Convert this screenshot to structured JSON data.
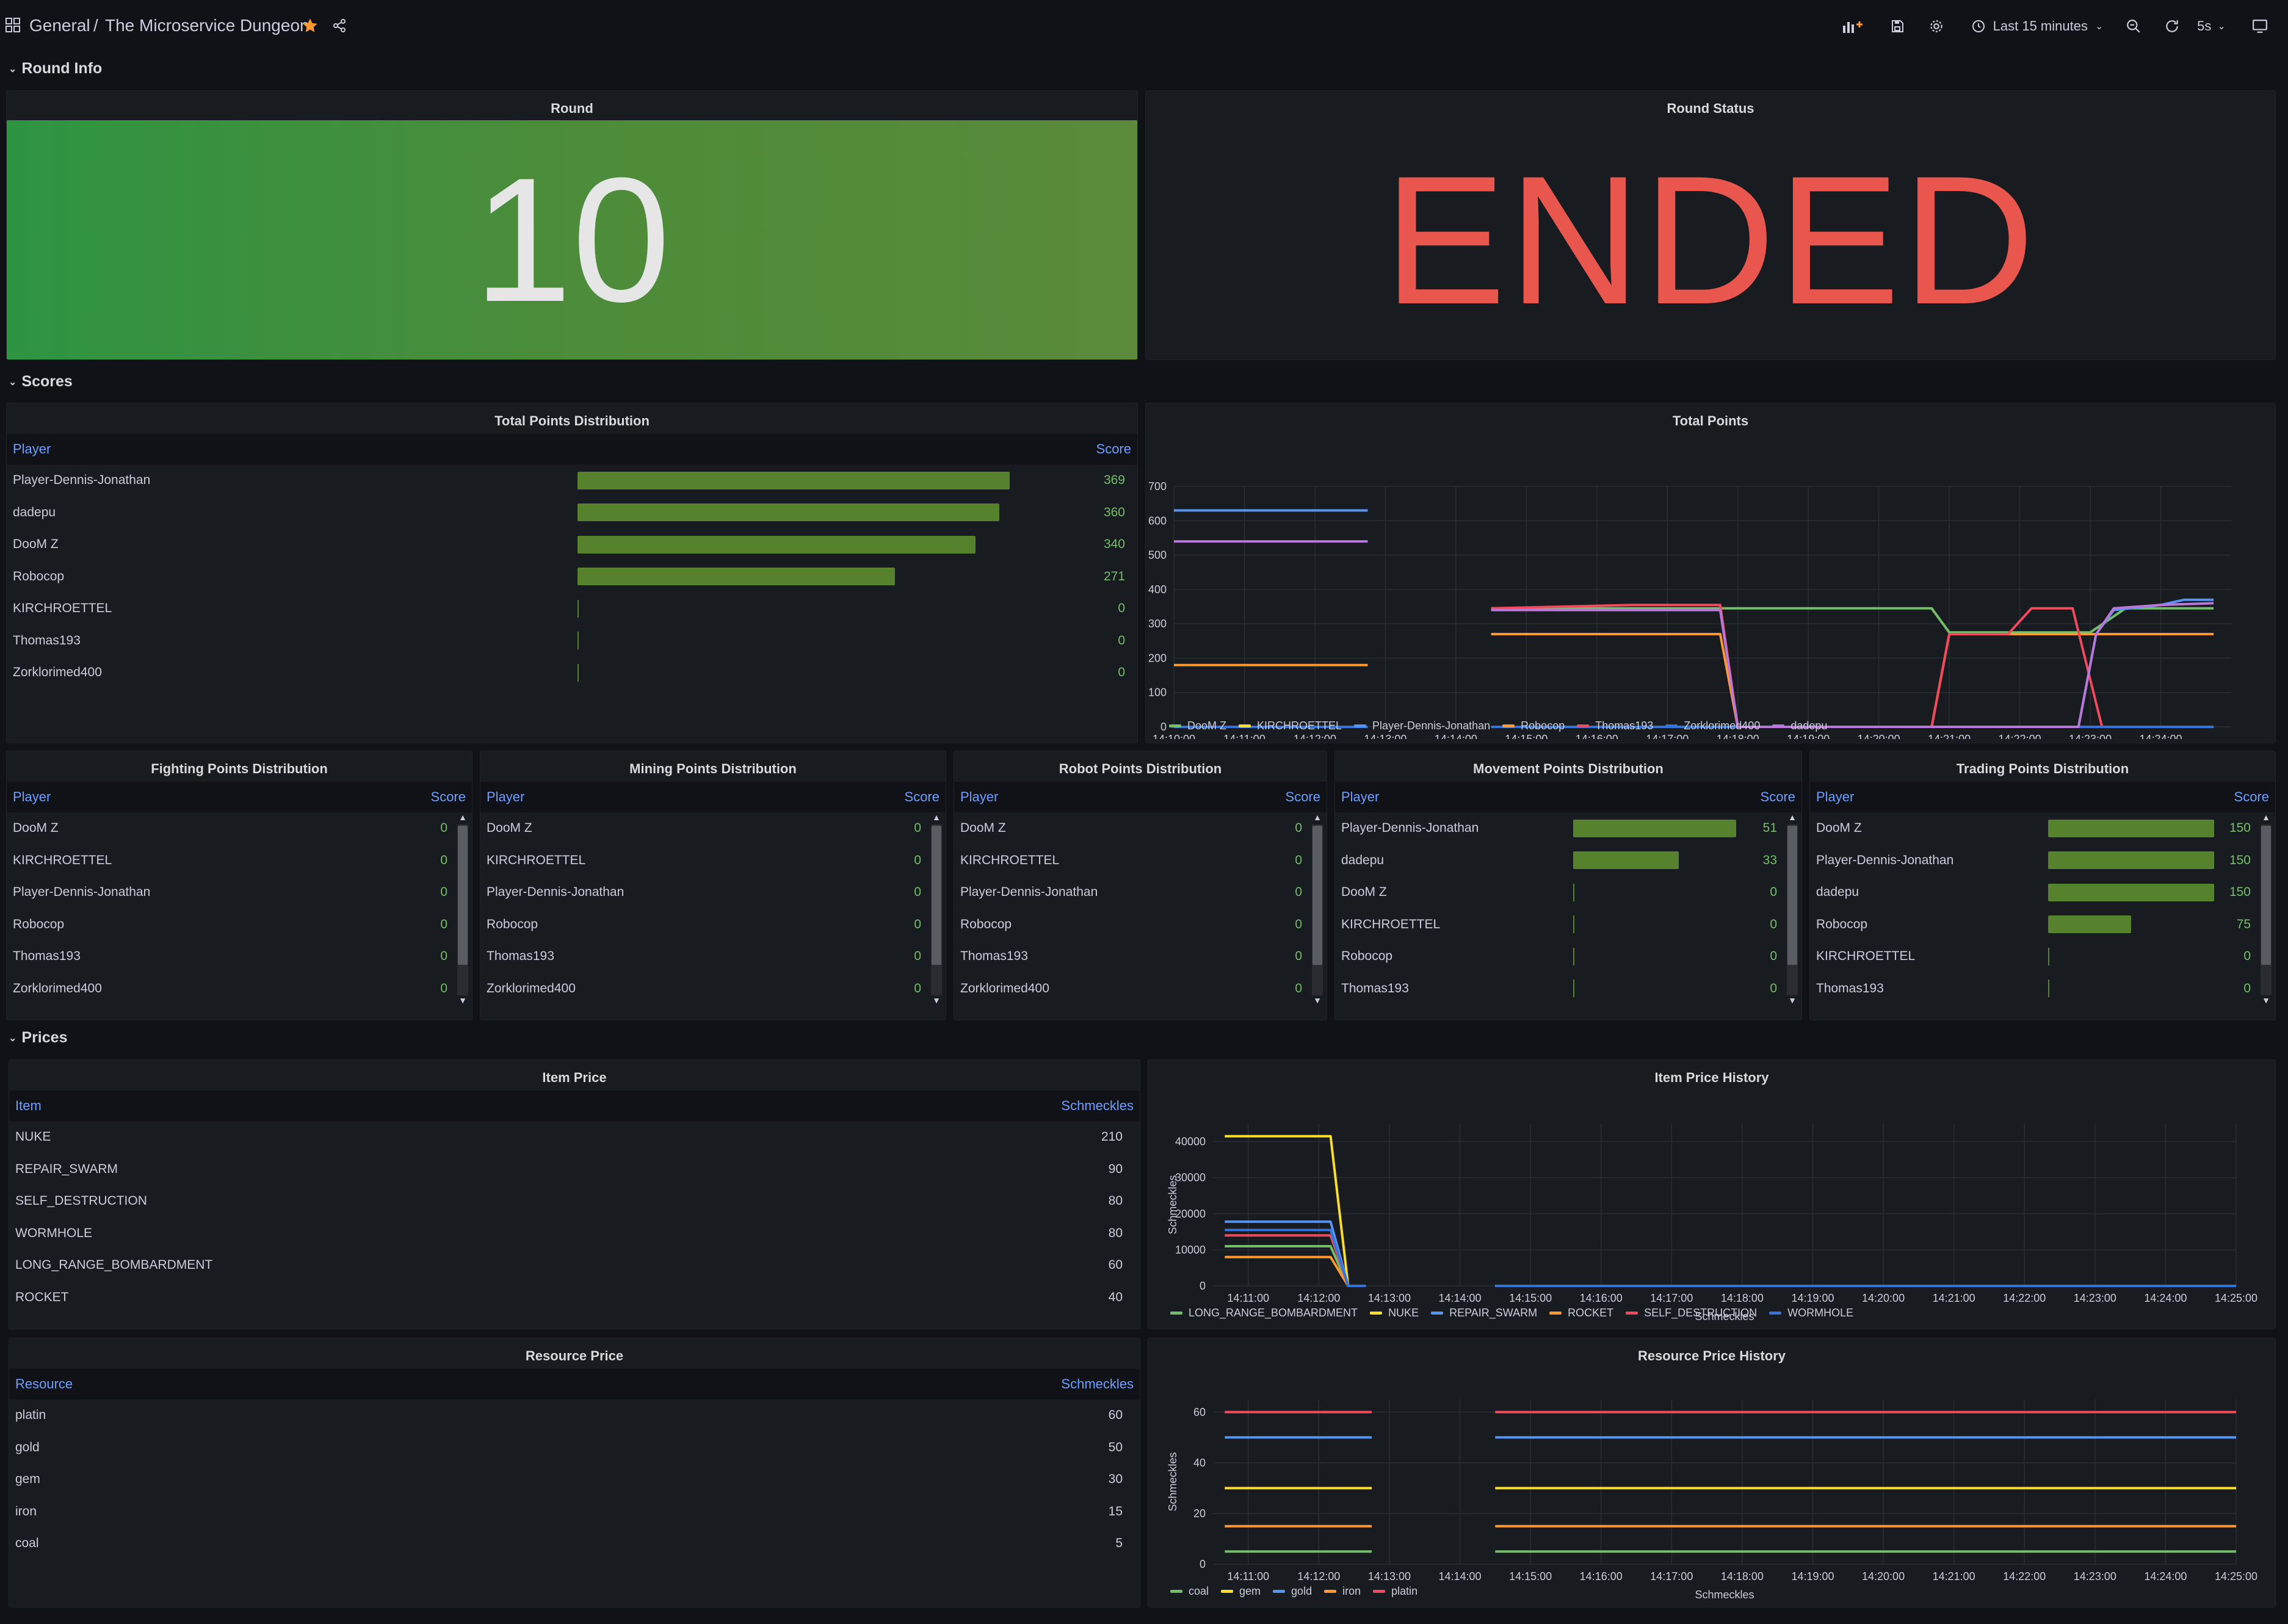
{
  "header": {
    "folder": "General",
    "separator": "/",
    "title": "The Microservice Dungeon",
    "time_range": "Last 15 minutes",
    "refresh": "5s"
  },
  "rows": {
    "round_info": "Round Info",
    "scores": "Scores",
    "prices": "Prices"
  },
  "round_panel": {
    "title": "Round",
    "value": "10",
    "bg": "#56822d"
  },
  "round_status_panel": {
    "title": "Round Status",
    "value": "ENDED",
    "color": "#e8564d"
  },
  "total_points_dist": {
    "title": "Total Points Distribution",
    "col_player": "Player",
    "col_score": "Score",
    "max": 370,
    "rows": [
      {
        "player": "Player-Dennis-Jonathan",
        "score": "369",
        "n": 369
      },
      {
        "player": "dadepu",
        "score": "360",
        "n": 360
      },
      {
        "player": "DooM Z",
        "score": "340",
        "n": 340
      },
      {
        "player": "Robocop",
        "score": "271",
        "n": 271
      },
      {
        "player": "KIRCHROETTEL",
        "score": "0",
        "n": 0
      },
      {
        "player": "Thomas193",
        "score": "0",
        "n": 0
      },
      {
        "player": "Zorklorimed400",
        "score": "0",
        "n": 0
      }
    ]
  },
  "fighting": {
    "title": "Fighting Points Distribution",
    "col_player": "Player",
    "col_score": "Score",
    "rows": [
      {
        "player": "DooM Z",
        "score": "0"
      },
      {
        "player": "KIRCHROETTEL",
        "score": "0"
      },
      {
        "player": "Player-Dennis-Jonathan",
        "score": "0"
      },
      {
        "player": "Robocop",
        "score": "0"
      },
      {
        "player": "Thomas193",
        "score": "0"
      },
      {
        "player": "Zorklorimed400",
        "score": "0"
      }
    ]
  },
  "mining": {
    "title": "Mining Points Distribution",
    "col_player": "Player",
    "col_score": "Score",
    "rows": [
      {
        "player": "DooM Z",
        "score": "0"
      },
      {
        "player": "KIRCHROETTEL",
        "score": "0"
      },
      {
        "player": "Player-Dennis-Jonathan",
        "score": "0"
      },
      {
        "player": "Robocop",
        "score": "0"
      },
      {
        "player": "Thomas193",
        "score": "0"
      },
      {
        "player": "Zorklorimed400",
        "score": "0"
      }
    ]
  },
  "robot": {
    "title": "Robot Points Distribution",
    "col_player": "Player",
    "col_score": "Score",
    "rows": [
      {
        "player": "DooM Z",
        "score": "0"
      },
      {
        "player": "KIRCHROETTEL",
        "score": "0"
      },
      {
        "player": "Player-Dennis-Jonathan",
        "score": "0"
      },
      {
        "player": "Robocop",
        "score": "0"
      },
      {
        "player": "Thomas193",
        "score": "0"
      },
      {
        "player": "Zorklorimed400",
        "score": "0"
      }
    ]
  },
  "movement": {
    "title": "Movement Points Distribution",
    "col_player": "Player",
    "col_score": "Score",
    "max": 52,
    "rows": [
      {
        "player": "Player-Dennis-Jonathan",
        "score": "51",
        "n": 51
      },
      {
        "player": "dadepu",
        "score": "33",
        "n": 33
      },
      {
        "player": "DooM Z",
        "score": "0",
        "n": 0
      },
      {
        "player": "KIRCHROETTEL",
        "score": "0",
        "n": 0
      },
      {
        "player": "Robocop",
        "score": "0",
        "n": 0
      },
      {
        "player": "Thomas193",
        "score": "0",
        "n": 0
      }
    ]
  },
  "trading": {
    "title": "Trading Points Distribution",
    "col_player": "Player",
    "col_score": "Score",
    "max": 150,
    "rows": [
      {
        "player": "DooM Z",
        "score": "150",
        "n": 150
      },
      {
        "player": "Player-Dennis-Jonathan",
        "score": "150",
        "n": 150
      },
      {
        "player": "dadepu",
        "score": "150",
        "n": 150
      },
      {
        "player": "Robocop",
        "score": "75",
        "n": 75
      },
      {
        "player": "KIRCHROETTEL",
        "score": "0",
        "n": 0
      },
      {
        "player": "Thomas193",
        "score": "0",
        "n": 0
      }
    ]
  },
  "item_price": {
    "title": "Item Price",
    "col_item": "Item",
    "col_val": "Schmeckles",
    "rows": [
      {
        "item": "NUKE",
        "val": "210"
      },
      {
        "item": "REPAIR_SWARM",
        "val": "90"
      },
      {
        "item": "SELF_DESTRUCTION",
        "val": "80"
      },
      {
        "item": "WORMHOLE",
        "val": "80"
      },
      {
        "item": "LONG_RANGE_BOMBARDMENT",
        "val": "60"
      },
      {
        "item": "ROCKET",
        "val": "40"
      }
    ]
  },
  "resource_price": {
    "title": "Resource Price",
    "col_item": "Resource",
    "col_val": "Schmeckles",
    "rows": [
      {
        "item": "platin",
        "val": "60"
      },
      {
        "item": "gold",
        "val": "50"
      },
      {
        "item": "gem",
        "val": "30"
      },
      {
        "item": "iron",
        "val": "15"
      },
      {
        "item": "coal",
        "val": "5"
      }
    ]
  },
  "chart_data": [
    {
      "type": "line",
      "title": "Total Points",
      "ylim": [
        0,
        700
      ],
      "yticks": [
        0,
        100,
        200,
        300,
        400,
        500,
        600,
        700
      ],
      "xlim": [
        "14:10:00",
        "14:25:00"
      ],
      "xticks": [
        "14:10:00",
        "14:11:00",
        "14:12:00",
        "14:13:00",
        "14:14:00",
        "14:15:00",
        "14:16:00",
        "14:17:00",
        "14:18:00",
        "14:19:00",
        "14:20:00",
        "14:21:00",
        "14:22:00",
        "14:23:00",
        "14:24:00"
      ],
      "legend_position": "bottom",
      "series": [
        {
          "name": "DooM Z",
          "color": "#73bf69",
          "points": [
            [
              "14:10:00",
              0
            ],
            [
              "14:12:45",
              0
            ],
            null,
            [
              "14:14:30",
              345
            ],
            [
              "14:20:45",
              345
            ],
            [
              "14:21:00",
              275
            ],
            [
              "14:23:00",
              275
            ],
            [
              "14:23:30",
              345
            ],
            [
              "14:24:45",
              345
            ]
          ]
        },
        {
          "name": "KIRCHROETTEL",
          "color": "#fade2a",
          "points": [
            [
              "14:10:00",
              0
            ],
            [
              "14:12:45",
              0
            ],
            null,
            [
              "14:14:30",
              0
            ],
            [
              "14:24:45",
              0
            ]
          ]
        },
        {
          "name": "Player-Dennis-Jonathan",
          "color": "#5794f2",
          "points": [
            [
              "14:10:00",
              630
            ],
            [
              "14:12:45",
              630
            ],
            null,
            [
              "14:14:30",
              0
            ],
            [
              "14:22:50",
              0
            ],
            [
              "14:23:05",
              270
            ],
            [
              "14:23:20",
              340
            ],
            [
              "14:24:00",
              355
            ],
            [
              "14:24:20",
              370
            ],
            [
              "14:24:45",
              370
            ]
          ]
        },
        {
          "name": "Robocop",
          "color": "#ff9830",
          "points": [
            [
              "14:10:00",
              180
            ],
            [
              "14:12:45",
              180
            ],
            null,
            [
              "14:14:30",
              270
            ],
            [
              "14:17:45",
              270
            ],
            [
              "14:18:00",
              0
            ],
            [
              "14:20:45",
              0
            ],
            [
              "14:21:00",
              270
            ],
            [
              "14:24:45",
              270
            ]
          ]
        },
        {
          "name": "Thomas193",
          "color": "#f2495c",
          "points": [
            [
              "14:10:00",
              0
            ],
            [
              "14:12:45",
              0
            ],
            null,
            [
              "14:14:30",
              345
            ],
            [
              "14:15:30",
              350
            ],
            [
              "14:16:30",
              355
            ],
            [
              "14:17:45",
              355
            ],
            [
              "14:18:00",
              0
            ],
            [
              "14:20:45",
              0
            ],
            [
              "14:21:00",
              270
            ],
            [
              "14:21:50",
              270
            ],
            [
              "14:22:10",
              345
            ],
            [
              "14:22:45",
              345
            ],
            [
              "14:23:10",
              0
            ],
            [
              "14:24:45",
              0
            ]
          ]
        },
        {
          "name": "Zorklorimed400",
          "color": "#3274d9",
          "points": [
            [
              "14:10:00",
              0
            ],
            [
              "14:12:45",
              0
            ],
            null,
            [
              "14:14:30",
              0
            ],
            [
              "14:24:45",
              0
            ]
          ]
        },
        {
          "name": "dadepu",
          "color": "#b877d9",
          "points": [
            [
              "14:10:00",
              540
            ],
            [
              "14:12:45",
              540
            ],
            null,
            [
              "14:14:30",
              340
            ],
            [
              "14:17:45",
              340
            ],
            [
              "14:18:00",
              0
            ],
            [
              "14:22:50",
              0
            ],
            [
              "14:23:05",
              270
            ],
            [
              "14:23:20",
              345
            ],
            [
              "14:24:00",
              355
            ],
            [
              "14:24:45",
              360
            ]
          ]
        }
      ]
    },
    {
      "type": "line",
      "title": "Item Price History",
      "xlabel": "Schmeckles",
      "ylabel": "Schmeckles",
      "ylim": [
        0,
        45000
      ],
      "yticks": [
        0,
        10000,
        20000,
        30000,
        40000
      ],
      "xlim": [
        "14:10:30",
        "14:25:00"
      ],
      "xticks": [
        "14:11:00",
        "14:12:00",
        "14:13:00",
        "14:14:00",
        "14:15:00",
        "14:16:00",
        "14:17:00",
        "14:18:00",
        "14:19:00",
        "14:20:00",
        "14:21:00",
        "14:22:00",
        "14:23:00",
        "14:24:00",
        "14:25:00"
      ],
      "legend_position": "bottom",
      "series": [
        {
          "name": "LONG_RANGE_BOMBARDMENT",
          "color": "#73bf69",
          "points": [
            [
              "14:10:40",
              11000
            ],
            [
              "14:12:10",
              11000
            ],
            [
              "14:12:25",
              0
            ],
            [
              "14:12:40",
              0
            ],
            null,
            [
              "14:14:30",
              0
            ],
            [
              "14:25:00",
              0
            ]
          ]
        },
        {
          "name": "NUKE",
          "color": "#fade2a",
          "points": [
            [
              "14:10:40",
              41500
            ],
            [
              "14:12:10",
              41500
            ],
            [
              "14:12:25",
              0
            ],
            [
              "14:12:40",
              0
            ],
            null,
            [
              "14:14:30",
              0
            ],
            [
              "14:25:00",
              0
            ]
          ]
        },
        {
          "name": "REPAIR_SWARM",
          "color": "#5794f2",
          "points": [
            [
              "14:10:40",
              17800
            ],
            [
              "14:12:10",
              17800
            ],
            [
              "14:12:25",
              0
            ],
            [
              "14:12:40",
              0
            ],
            null,
            [
              "14:14:30",
              0
            ],
            [
              "14:25:00",
              0
            ]
          ]
        },
        {
          "name": "ROCKET",
          "color": "#ff9830",
          "points": [
            [
              "14:10:40",
              8000
            ],
            [
              "14:12:10",
              8000
            ],
            [
              "14:12:25",
              0
            ],
            [
              "14:12:40",
              0
            ],
            null,
            [
              "14:14:30",
              0
            ],
            [
              "14:25:00",
              0
            ]
          ]
        },
        {
          "name": "SELF_DESTRUCTION",
          "color": "#f2495c",
          "points": [
            [
              "14:10:40",
              14000
            ],
            [
              "14:12:10",
              14000
            ],
            [
              "14:12:25",
              0
            ],
            [
              "14:12:40",
              0
            ],
            null,
            [
              "14:14:30",
              0
            ],
            [
              "14:25:00",
              0
            ]
          ]
        },
        {
          "name": "WORMHOLE",
          "color": "#3274d9",
          "points": [
            [
              "14:10:40",
              15500
            ],
            [
              "14:12:10",
              15500
            ],
            [
              "14:12:25",
              0
            ],
            [
              "14:12:40",
              0
            ],
            null,
            [
              "14:14:30",
              0
            ],
            [
              "14:25:00",
              0
            ]
          ]
        }
      ]
    },
    {
      "type": "line",
      "title": "Resource Price History",
      "xlabel": "Schmeckles",
      "ylabel": "Schmeckles",
      "ylim": [
        0,
        65
      ],
      "yticks": [
        0,
        20,
        40,
        60
      ],
      "xlim": [
        "14:10:30",
        "14:25:00"
      ],
      "xticks": [
        "14:11:00",
        "14:12:00",
        "14:13:00",
        "14:14:00",
        "14:15:00",
        "14:16:00",
        "14:17:00",
        "14:18:00",
        "14:19:00",
        "14:20:00",
        "14:21:00",
        "14:22:00",
        "14:23:00",
        "14:24:00",
        "14:25:00"
      ],
      "legend_position": "bottom",
      "series": [
        {
          "name": "coal",
          "color": "#73bf69",
          "points": [
            [
              "14:10:40",
              5
            ],
            [
              "14:12:45",
              5
            ],
            null,
            [
              "14:14:30",
              5
            ],
            [
              "14:25:00",
              5
            ]
          ]
        },
        {
          "name": "gem",
          "color": "#fade2a",
          "points": [
            [
              "14:10:40",
              30
            ],
            [
              "14:12:45",
              30
            ],
            null,
            [
              "14:14:30",
              30
            ],
            [
              "14:25:00",
              30
            ]
          ]
        },
        {
          "name": "gold",
          "color": "#5794f2",
          "points": [
            [
              "14:10:40",
              50
            ],
            [
              "14:12:45",
              50
            ],
            null,
            [
              "14:14:30",
              50
            ],
            [
              "14:25:00",
              50
            ]
          ]
        },
        {
          "name": "iron",
          "color": "#ff9830",
          "points": [
            [
              "14:10:40",
              15
            ],
            [
              "14:12:45",
              15
            ],
            null,
            [
              "14:14:30",
              15
            ],
            [
              "14:25:00",
              15
            ]
          ]
        },
        {
          "name": "platin",
          "color": "#f2495c",
          "points": [
            [
              "14:10:40",
              60
            ],
            [
              "14:12:45",
              60
            ],
            null,
            [
              "14:14:30",
              60
            ],
            [
              "14:25:00",
              60
            ]
          ]
        }
      ]
    }
  ]
}
